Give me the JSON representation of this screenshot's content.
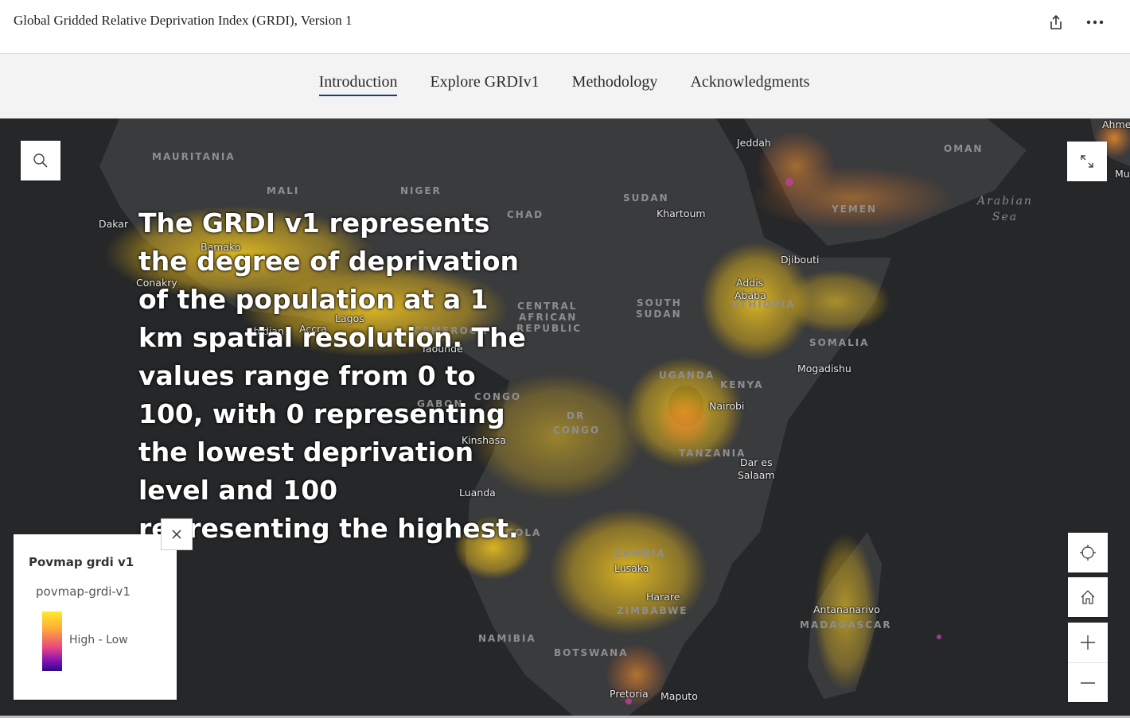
{
  "header": {
    "title": "Global Gridded Relative Deprivation Index (GRDI), Version 1",
    "share_icon": "share-icon",
    "more_icon": "more-options-icon"
  },
  "nav": {
    "tabs": [
      {
        "label": "Introduction",
        "active": true
      },
      {
        "label": "Explore GRDIv1",
        "active": false
      },
      {
        "label": "Methodology",
        "active": false
      },
      {
        "label": "Acknowledgments",
        "active": false
      }
    ]
  },
  "map": {
    "overlay_text": "The GRDI v1 represents the degree of deprivation of the population at a 1 km spatial resolution. The values range from 0 to 100, with 0 representing the lowest deprivation level and 100 representing the highest.",
    "country_labels": [
      "MAURITANIA",
      "MALI",
      "NIGER",
      "CHAD",
      "SUDAN",
      "SOUTH",
      "SUDAN",
      "CENTRAL",
      "AFRICAN",
      "REPUBLIC",
      "CAMEROON",
      "GABON",
      "CONGO",
      "DR",
      "CONGO",
      "ETHIOPIA",
      "SOMALIA",
      "KENYA",
      "UGANDA",
      "TANZANIA",
      "ANGOLA",
      "ZAMBIA",
      "ZIMBABWE",
      "NAMIBIA",
      "BOTSWANA",
      "MADAGASCAR",
      "YEMEN",
      "OMAN"
    ],
    "city_labels": [
      "Dakar",
      "Bamako",
      "Conakry",
      "Abidjan",
      "Accra",
      "Lagos",
      "Yaoundé",
      "Kinshasa",
      "Luanda",
      "Khartoum",
      "Jeddah",
      "Djibouti",
      "Addis",
      "Ababa",
      "Mogadishu",
      "Nairobi",
      "Dar es",
      "Salaam",
      "Lusaka",
      "Harare",
      "Antananarivo",
      "Pretoria",
      "Maputo",
      "Ahmed",
      "Mu"
    ],
    "sea_label": "Arabian\nSea",
    "colors": {
      "low": "#2b0a8a",
      "mid": "#e8487e",
      "high": "#ffea2b",
      "background": "#252729"
    }
  },
  "legend": {
    "title": "Povmap grdi v1",
    "layer": "povmap-grdi-v1",
    "range_label": "High - Low",
    "close_icon": "close-icon"
  },
  "controls": {
    "search_icon": "search-icon",
    "expand_icon": "expand-icon",
    "locate_icon": "locate-icon",
    "home_icon": "home-icon",
    "zoom_in_icon": "plus-icon",
    "zoom_out_icon": "minus-icon"
  }
}
